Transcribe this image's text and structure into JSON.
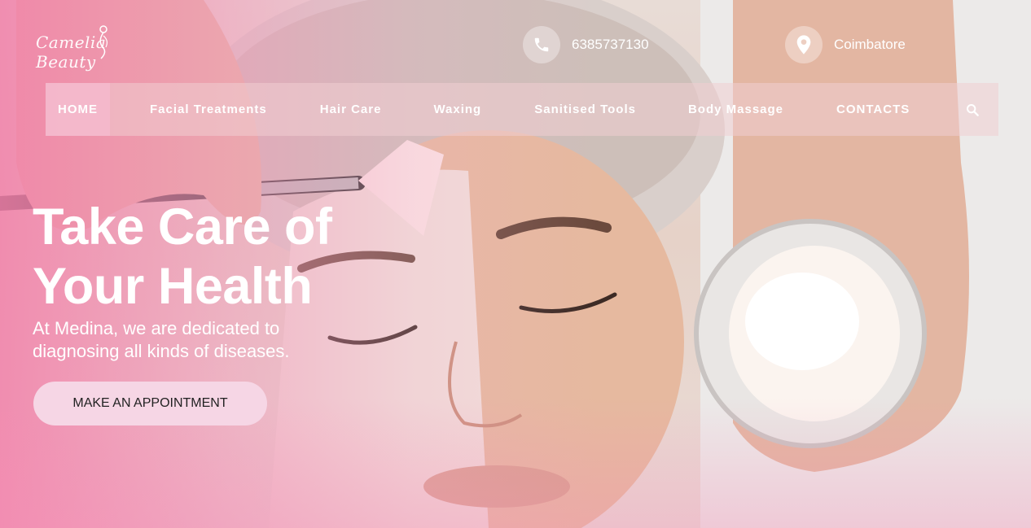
{
  "brand": {
    "logo_text": "Camelia Beauty"
  },
  "contact": {
    "phone": "6385737130",
    "location": "Coimbatore"
  },
  "nav": {
    "items": [
      {
        "label": "HOME",
        "active": true
      },
      {
        "label": "Facial Treatments",
        "active": false
      },
      {
        "label": "Hair Care",
        "active": false
      },
      {
        "label": "Waxing",
        "active": false
      },
      {
        "label": "Sanitised Tools",
        "active": false
      },
      {
        "label": "Body Massage",
        "active": false
      },
      {
        "label": "CONTACTS",
        "active": false
      }
    ],
    "search_icon": "search-icon"
  },
  "hero": {
    "title_line1": "Take Care of",
    "title_line2": "Your Health",
    "subtitle_line1": "At Medina, we are dedicated to",
    "subtitle_line2": "diagnosing all kinds of diseases.",
    "cta_label": "MAKE AN APPOINTMENT"
  },
  "colors": {
    "accent_pink": "#f28aa9",
    "cta_bg": "#f6d6e5",
    "nav_bg": "#f0cdd2"
  }
}
